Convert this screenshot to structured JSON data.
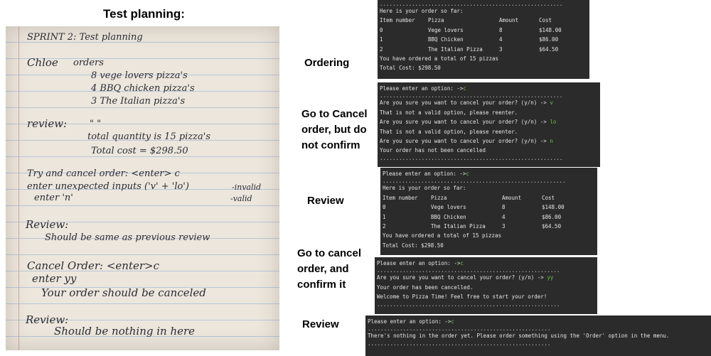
{
  "title": "Test planning:",
  "notes": {
    "sprint": "SPRINT 2: Test planning",
    "chloe": "Chloe",
    "orders": "orders",
    "order_lines": [
      "8 vege lovers pizza's",
      "4 BBQ chicken pizza's",
      "3 The Italian pizza's"
    ],
    "review_label": "review:",
    "ditto": "\"     \"",
    "total_qty": "total quantity is 15 pizza's",
    "total_cost": "Total cost = $298.50",
    "try_cancel": "Try and cancel order: <enter> c",
    "unexpected": "enter unexpected inputs ('v' + 'lo')",
    "invalid": "-invalid",
    "enter_n": "enter 'n'",
    "valid": "-valid",
    "review2": "Review:",
    "same_prev": "Should be same as previous review",
    "cancel_order": "Cancel Order: <enter>c",
    "enter_yy": "enter yy",
    "your_order": "Your order should be canceled",
    "review3": "Review:",
    "nothing": "Should be nothing in here"
  },
  "labels": {
    "ordering": "Ordering",
    "cancel_no_confirm": [
      "Go to Cancel",
      "order, but do",
      "not confirm"
    ],
    "review1": "Review",
    "cancel_confirm": [
      "Go to cancel",
      "order, and",
      "confirm it"
    ],
    "review2": "Review"
  },
  "terminals": {
    "dots": ".........................................................",
    "prompt": "Please enter an option: ->",
    "prompt_c": "c",
    "order_header": "Here is your order so far:",
    "columns": [
      "Item number",
      "Pizza",
      "Amount",
      "Cost"
    ],
    "items": [
      [
        "0",
        "Vege lovers",
        "8",
        "$148.00"
      ],
      [
        "1",
        "BBQ Chicken",
        "4",
        "$86.00"
      ],
      [
        "2",
        "The Italian Pizza",
        "3",
        "$64.50"
      ]
    ],
    "total_qty": "You have ordered a total of 15 pizzas",
    "total_cost": "Total Cost: $298.50",
    "confirm_q": "Are you sure you want to cancel your order? (y/n) ->",
    "ans_n_lower": "n",
    "ans_v": "v",
    "ans_lo": "lo",
    "not_valid": "That is not a valid option, please reenter.",
    "not_cancelled": "Your order has not been cancelled",
    "ans_yy": "yy",
    "cancelled": "Your order has been cancelled.",
    "welcome": "Welcome to Pizza Time! Feel free to start your order!",
    "nothing": "There's nothing in the order yet. Please order something using the 'Order' option in the menu."
  },
  "colors": {
    "terminal_bg": "#2b2b2b",
    "terminal_text": "#e6e6e6",
    "input_green": "#6fbf4a"
  }
}
